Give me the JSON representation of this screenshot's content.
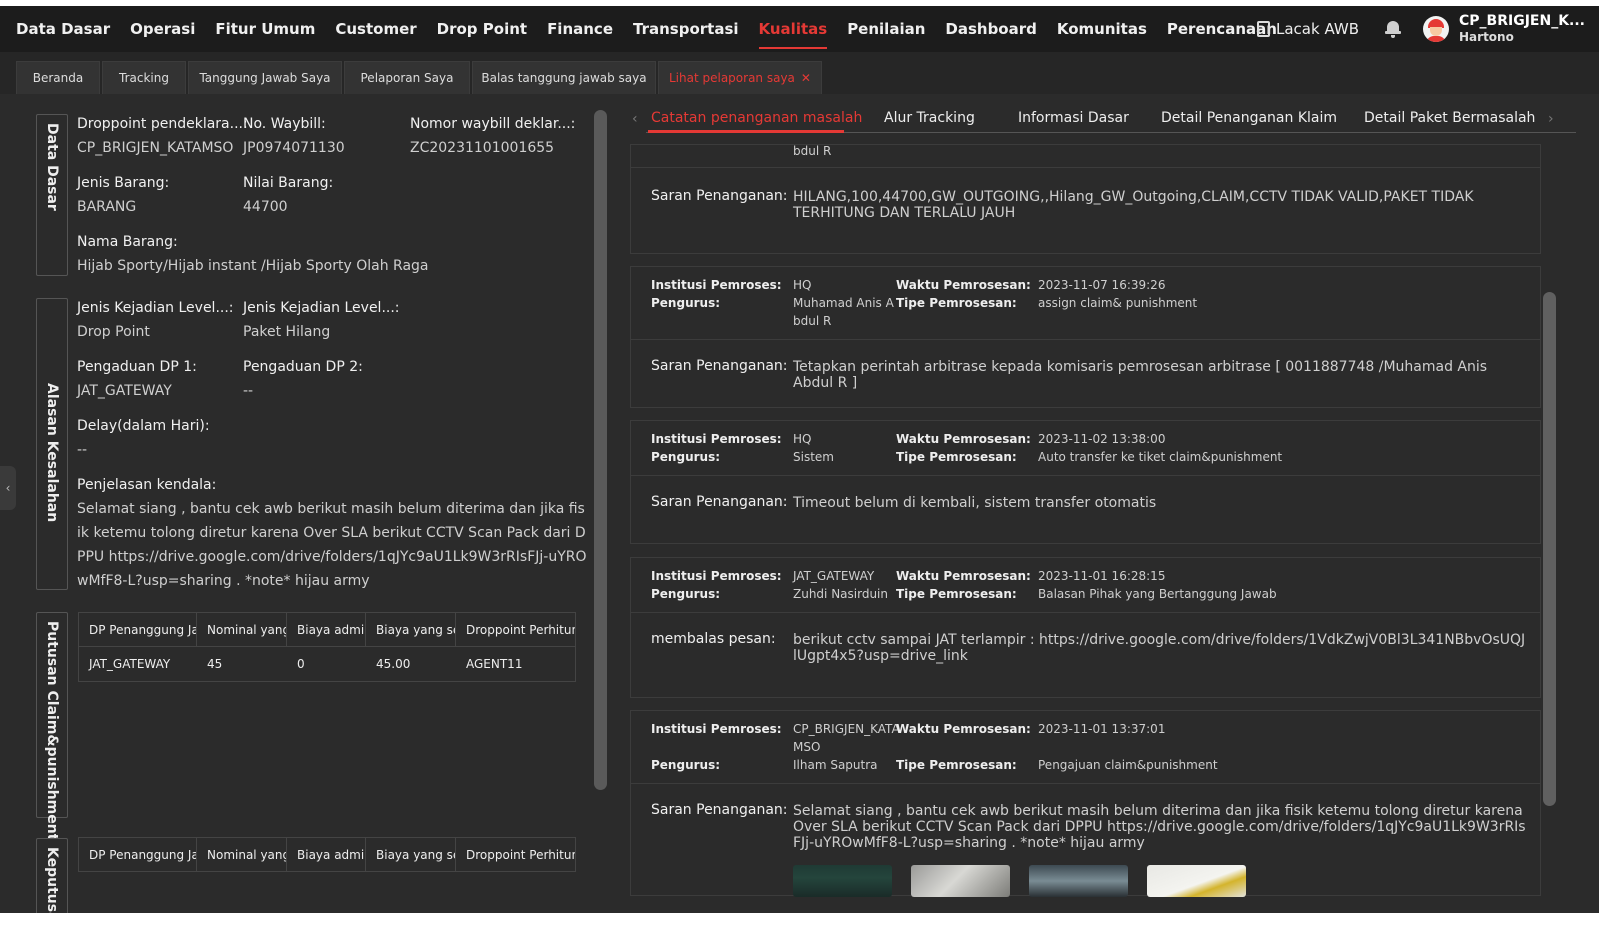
{
  "nav": {
    "menu": [
      "Data Dasar",
      "Operasi",
      "Fitur Umum",
      "Customer",
      "Drop Point",
      "Finance",
      "Transportasi",
      "Kualitas",
      "Penilaian",
      "Dashboard",
      "Komunitas",
      "Perencanaan"
    ],
    "active": "Kualitas",
    "lacak_awb": "Lacak AWB",
    "user_name": "CP_BRIGJEN_K...",
    "user_sub": "Hartono"
  },
  "tabs": [
    "Beranda",
    "Tracking",
    "Tanggung Jawab Saya",
    "Pelaporan Saya",
    "Balas tanggung jawab saya",
    "Lihat pelaporan saya"
  ],
  "left": {
    "sections": {
      "data_dasar": "Data Dasar",
      "alasan": "Alasan Kesalahan",
      "putusan": "Putusan Claim&punishment",
      "keputusan": "Keputusan"
    },
    "dp_label": "Droppoint pendeklara...:",
    "dp_value": "CP_BRIGJEN_KATAMSO",
    "waybill_label": "No. Waybill:",
    "waybill_value": "JP0974071130",
    "nomor_label": "Nomor waybill deklar...:",
    "nomor_value": "ZC20231101001655",
    "jenis_barang_label": "Jenis Barang:",
    "jenis_barang_value": "BARANG",
    "nilai_label": "Nilai Barang:",
    "nilai_value": "44700",
    "nama_label": "Nama Barang:",
    "nama_value": "Hijab Sporty/Hijab instant /Hijab Sporty Olah Raga",
    "kejadian1_label": "Jenis Kejadian Level...:",
    "kejadian1_value": "Drop Point",
    "kejadian2_label": "Jenis Kejadian Level...:",
    "kejadian2_value": "Paket Hilang",
    "pengaduan1_label": "Pengaduan DP 1:",
    "pengaduan1_value": "JAT_GATEWAY",
    "pengaduan2_label": "Pengaduan DP 2:",
    "pengaduan2_value": "--",
    "delay_label": "Delay(dalam Hari):",
    "delay_value": "--",
    "penjelasan_label": "Penjelasan kendala:",
    "penjelasan_value": "Selamat siang , bantu cek awb berikut masih belum diterima dan jika fisik ketemu tolong diretur karena Over SLA berikut CCTV Scan Pack dari DPPU https://drive.google.com/drive/folders/1qJYc9aU1Lk9W3rRIsFJj-uYROwMfF8-L?usp=sharing . *note* hijau army",
    "table_headers": [
      "DP Penanggung Jawab",
      "Nominal yang",
      "Biaya admin",
      "Biaya yang sel",
      "Droppoint Perhitun"
    ],
    "table_row": [
      "JAT_GATEWAY",
      "45",
      "0",
      "45.00",
      "AGENT11"
    ]
  },
  "right": {
    "tabs": [
      "Catatan penanganan masalah",
      "Alur Tracking",
      "Informasi Dasar",
      "Detail Penanganan Klaim",
      "Detail Paket Bermasalah"
    ],
    "lbl_inst": "Institusi Pemroses:",
    "lbl_peng": "Pengurus:",
    "lbl_waktu": "Waktu Pemrosesan:",
    "lbl_tipe": "Tipe Pemrosesan:",
    "lbl_saran": "Saran Penanganan:",
    "lbl_balas": "membalas pesan:",
    "card0": {
      "pengurus_tail": "bdul R",
      "saran": "HILANG,100,44700,GW_OUTGOING,,Hilang_GW_Outgoing,CLAIM,CCTV TIDAK VALID,PAKET TIDAK TERHITUNG DAN TERLALU JAUH"
    },
    "card1": {
      "inst": "HQ",
      "peng": "Muhamad Anis A",
      "peng2": "bdul R",
      "waktu": "2023-11-07 16:39:26",
      "tipe": "assign claim& punishment",
      "saran": "Tetapkan perintah arbitrase kepada komisaris pemrosesan arbitrase [ 0011887748 /Muhamad Anis Abdul R ]"
    },
    "card2": {
      "inst": "HQ",
      "peng": "Sistem",
      "waktu": "2023-11-02 13:38:00",
      "tipe": "Auto transfer ke tiket claim&punishment",
      "saran": "Timeout belum di kembali, sistem transfer otomatis"
    },
    "card3": {
      "inst": "JAT_GATEWAY",
      "peng": "Zuhdi Nasirduin",
      "waktu": "2023-11-01 16:28:15",
      "tipe": "Balasan Pihak yang Bertanggung Jawab",
      "saran": "berikut cctv sampai JAT terlampir : https://drive.google.com/drive/folders/1VdkZwjV0Bl3L341NBbvOsUQJlUgpt4x5?usp=drive_link"
    },
    "card4": {
      "inst": "CP_BRIGJEN_KATA",
      "inst2": "MSO",
      "peng": "Ilham Saputra",
      "waktu": "2023-11-01 13:37:01",
      "tipe": "Pengajuan claim&punishment",
      "saran": "Selamat siang , bantu cek awb berikut masih belum diterima dan jika fisik ketemu tolong diretur karena Over SLA berikut CCTV Scan Pack dari DPPU https://drive.google.com/drive/folders/1qJYc9aU1Lk9W3rRIsFJj-uYROwMfF8-L?usp=sharing . *note* hijau army"
    }
  },
  "colors": {
    "accent": "#e53935",
    "bg": "#2b2b2b",
    "topbar": "#1c1c1c"
  }
}
